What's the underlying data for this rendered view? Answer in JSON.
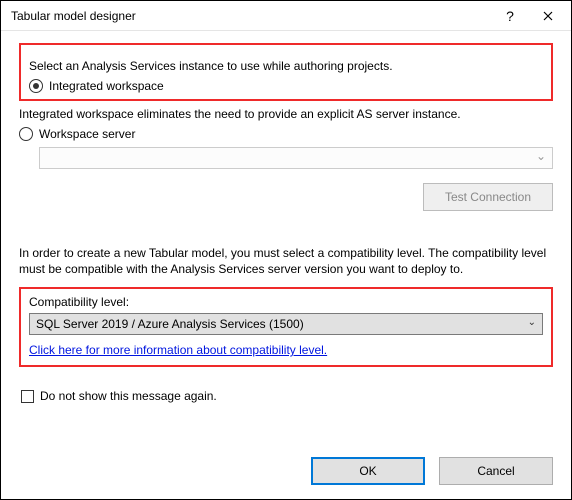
{
  "title": "Tabular model designer",
  "instruction": "Select an Analysis Services instance to use while authoring projects.",
  "radio_integrated": "Integrated workspace",
  "integrated_desc": "Integrated workspace eliminates the need to provide an explicit AS server instance.",
  "radio_server": "Workspace server",
  "test_connection": "Test Connection",
  "compat_paragraph": "In order to create a new Tabular model, you must select a compatibility level. The compatibility level must be compatible with the Analysis Services server version you want to deploy to.",
  "compat_label": "Compatibility level:",
  "compat_value": "SQL Server 2019 / Azure Analysis Services (1500)",
  "compat_link": "Click here for more information about compatibility level.",
  "dont_show": "Do not show this message again.",
  "ok": "OK",
  "cancel": "Cancel"
}
